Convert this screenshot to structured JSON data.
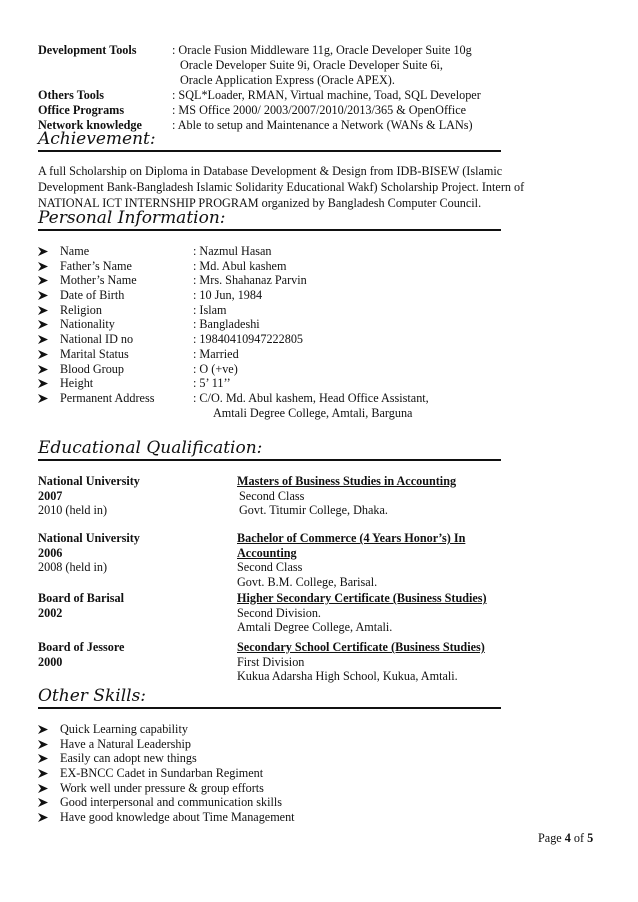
{
  "technical_skills": {
    "development_tools": {
      "label": "Development Tools",
      "value": ": Oracle Fusion Middleware 11g, Oracle Developer Suite 10g",
      "continuation": [
        "Oracle Developer Suite 9i, Oracle Developer Suite 6i,",
        "Oracle Application Express (Oracle APEX)."
      ]
    },
    "others_tools": {
      "label": "Others Tools",
      "value": ": SQL*Loader, RMAN, Virtual machine, Toad, SQL Developer"
    },
    "office_programs": {
      "label": "Office Programs",
      "value": ": MS Office 2000/ 2003/2007/2010/2013/365 & OpenOffice"
    },
    "network_knowledge": {
      "label": "Network knowledge",
      "value": ": Able to setup and Maintenance a Network (WANs & LANs)"
    }
  },
  "achievement": {
    "heading": "Achievement:",
    "text": "A full Scholarship on Diploma in Database Development & Design from IDB-BISEW (Islamic Development Bank-Bangladesh Islamic Solidarity Educational Wakf) Scholarship Project. Intern of NATIONAL ICT INTERNSHIP PROGRAM organized by Bangladesh Computer Council.",
    "lines": [
      "A full Scholarship on Diploma in Database Development & Design from IDB-BISEW (Islamic",
      "Development Bank-Bangladesh Islamic Solidarity Educational Wakf) Scholarship Project. Intern of",
      "NATIONAL ICT INTERNSHIP PROGRAM organized by Bangladesh Computer Council."
    ]
  },
  "personal_information": {
    "heading": "Personal Information:",
    "items": [
      {
        "label": "Name",
        "value": ": Nazmul Hasan"
      },
      {
        "label": "Father’s Name",
        "value": ": Md. Abul kashem"
      },
      {
        "label": "Mother’s Name",
        "value": ": Mrs. Shahanaz Parvin"
      },
      {
        "label": "Date of Birth",
        "value": ": 10 Jun, 1984"
      },
      {
        "label": "Religion",
        "value": ": Islam"
      },
      {
        "label": "Nationality",
        "value": ": Bangladeshi"
      },
      {
        "label": "National ID no",
        "value": ": 19840410947222805"
      },
      {
        "label": "Marital Status",
        "value": ": Married"
      },
      {
        "label": "Blood Group",
        "value": ": O (+ve)"
      },
      {
        "label": "Height",
        "value": ":  5’ 11’’"
      },
      {
        "label": "Permanent Address",
        "value": ": C/O. Md. Abul kashem, Head Office Assistant,",
        "continuation": "Amtali Degree College, Amtali, Barguna"
      }
    ]
  },
  "education": {
    "heading": "Educational Qualification:",
    "entries": [
      {
        "institution": "National University",
        "year": "2007",
        "held_in": "2010 (held in)",
        "degree_lines": [
          "Masters of Business Studies in Accounting"
        ],
        "result": "Second Class",
        "college": "Govt. Titumir College, Dhaka."
      },
      {
        "institution": "National University",
        "year": "2006",
        "held_in": "2008 (held in)",
        "degree_lines": [
          "Bachelor of Commerce (4 Years Honor’s) In",
          "Accounting"
        ],
        "result": "Second Class",
        "college": "Govt. B.M. College, Barisal."
      },
      {
        "institution": "Board of Barisal",
        "year": "2002",
        "held_in": "",
        "degree_lines": [
          "Higher Secondary Certificate (Business Studies)"
        ],
        "result": "Second Division.",
        "college": "Amtali Degree College, Amtali."
      },
      {
        "institution": "Board of Jessore",
        "year": "2000",
        "held_in": "",
        "degree_lines": [
          "Secondary School Certificate (Business Studies)"
        ],
        "result": "First Division",
        "college": "Kukua Adarsha High School, Kukua, Amtali."
      }
    ]
  },
  "other_skills": {
    "heading": "Other Skills:",
    "items": [
      "Quick Learning capability",
      "Have a Natural Leadership",
      "Easily can adopt new things",
      "EX-BNCC Cadet in Sundarban Regiment",
      "Work well under pressure & group efforts",
      "Good interpersonal and communication skills",
      "Have good knowledge about Time Management"
    ]
  },
  "footer": {
    "page_prefix": "Page ",
    "page_current": "4",
    "page_of": " of ",
    "page_total": "5"
  },
  "icons": {
    "bullet": "arrow-bullet-icon"
  }
}
